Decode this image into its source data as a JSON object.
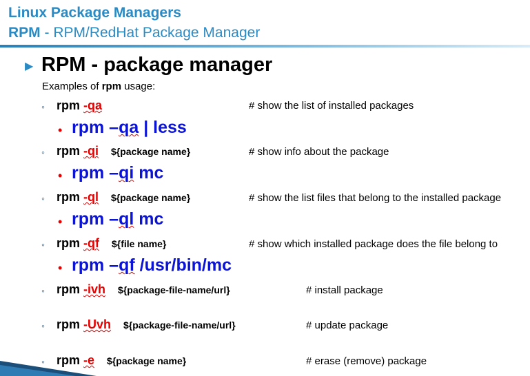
{
  "header": {
    "title": "Linux Package Managers",
    "subtitle_bold": "RPM",
    "subtitle_rest": " - RPM/RedHat Package Manager"
  },
  "main": {
    "title": "RPM - package manager",
    "examples_prefix": "Examples of ",
    "examples_bold": "rpm",
    "examples_suffix": " usage:"
  },
  "rows": [
    {
      "cmd": "rpm ",
      "flag": "-qa",
      "arg": "",
      "comment": "# show the list of installed packages"
    },
    {
      "cmd": "rpm ",
      "flag": "-qi",
      "arg": "${package name}",
      "comment": "# show info about the package"
    },
    {
      "cmd": "rpm ",
      "flag": "-ql",
      "arg": "${package name}",
      "comment": "# show the list files that belong to the installed package"
    },
    {
      "cmd": "rpm ",
      "flag": "-qf",
      "arg": "${file name}",
      "comment": "# show which installed package does the file belong to"
    },
    {
      "cmd": "rpm ",
      "flag": "-ivh",
      "arg": "${package-file-name/url}",
      "comment": "# install package"
    },
    {
      "cmd": "rpm ",
      "flag": "-Uvh",
      "arg": "${package-file-name/url}",
      "comment": "# update package"
    },
    {
      "cmd": "rpm ",
      "flag": "-e",
      "arg": "${package name}",
      "comment": "# erase (remove) package"
    }
  ],
  "examples": [
    {
      "prefix": "rpm –",
      "sq": "qa",
      "suffix": " | less"
    },
    {
      "prefix": "rpm –",
      "sq": "qi",
      "suffix": " mc"
    },
    {
      "prefix": "rpm –",
      "sq": "ql",
      "suffix": " mc"
    },
    {
      "prefix": "rpm –",
      "sq": "qf",
      "suffix": " /usr/bin/mc"
    }
  ],
  "icons": {
    "main_bullet": "triangle-right-icon",
    "sub_bullet": "ring-icon",
    "example_bullet": "dot-icon"
  },
  "colors": {
    "header": "#2a8bc4",
    "flag": "#e60000",
    "example": "#0b13d4"
  }
}
